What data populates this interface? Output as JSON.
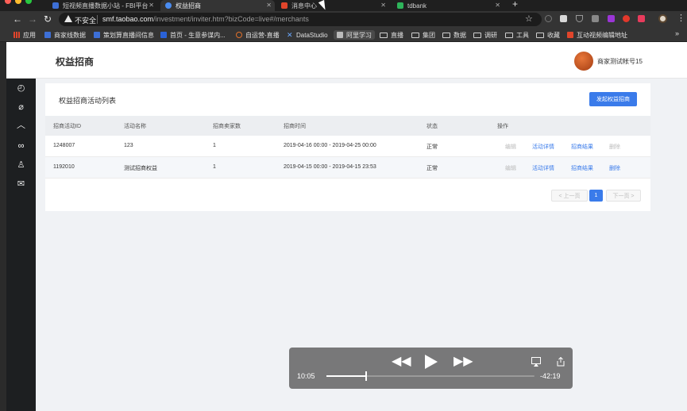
{
  "browser": {
    "tabs": [
      {
        "title": "短视频直播数据小站 - FBI平台",
        "active": false
      },
      {
        "title": "权益招商",
        "active": true
      },
      {
        "title": "消息中心",
        "active": false
      },
      {
        "title": "tdbank",
        "active": false
      }
    ],
    "new_tab": "+",
    "address": {
      "security_label": "不安全",
      "host": "smf.taobao.com",
      "path": "/investment/inviter.htm?bizCode=live#/merchants"
    },
    "bookmarks": [
      {
        "label": "应用",
        "icon": "apps-grid-icon"
      },
      {
        "label": "商家线数据",
        "icon": "bookmark-f-icon"
      },
      {
        "label": "策划算直播间信息",
        "icon": "bookmark-f-icon"
      },
      {
        "label": "首页 - 生意参谋内...",
        "icon": "bookmark-page-icon"
      },
      {
        "label": "自运营-直播",
        "icon": "bookmark-clock-icon"
      },
      {
        "label": "DataStudio",
        "icon": "datastudio-icon"
      },
      {
        "label": "阿里学习",
        "icon": "alilearn-icon"
      },
      {
        "label": "直播",
        "icon": "folder-icon"
      },
      {
        "label": "集团",
        "icon": "folder-icon"
      },
      {
        "label": "数据",
        "icon": "folder-icon"
      },
      {
        "label": "调研",
        "icon": "folder-icon"
      },
      {
        "label": "工具",
        "icon": "folder-icon"
      },
      {
        "label": "收藏",
        "icon": "folder-icon"
      },
      {
        "label": "互动视频编辑地址",
        "icon": "bookmark-m-icon"
      }
    ],
    "bookmarks_more": "»"
  },
  "page": {
    "title": "权益招商",
    "user_name": "商家测试帐号15",
    "sidebar_icons": [
      "clock-icon",
      "paperclip-icon",
      "chevron-up-icon",
      "link-icon",
      "user-icon",
      "mail-icon"
    ],
    "card_title": "权益招商活动列表",
    "primary_button": "发起权益招商",
    "table": {
      "headers": [
        "招商活动ID",
        "活动名称",
        "招商卖家数",
        "招商时间",
        "状态",
        "操作"
      ],
      "rows": [
        {
          "id": "1248007",
          "name": "123",
          "sellers": "1",
          "time": "2019-04-16 00:00 - 2019-04-25 00:00",
          "status": "正常",
          "actions": [
            "编辑",
            "活动详情",
            "招商结果",
            "删除"
          ]
        },
        {
          "id": "1192010",
          "name": "测试招商权益",
          "sellers": "1",
          "time": "2019-04-15 00:00 - 2019-04-15 23:53",
          "status": "正常",
          "actions": [
            "编辑",
            "活动详情",
            "招商结果",
            "删除"
          ]
        }
      ]
    },
    "pagination": {
      "prev": "< 上一页",
      "current": "1",
      "next": "下一页 >"
    }
  },
  "video": {
    "elapsed": "10:05",
    "remaining": "-42:19",
    "progress": 0.19
  }
}
